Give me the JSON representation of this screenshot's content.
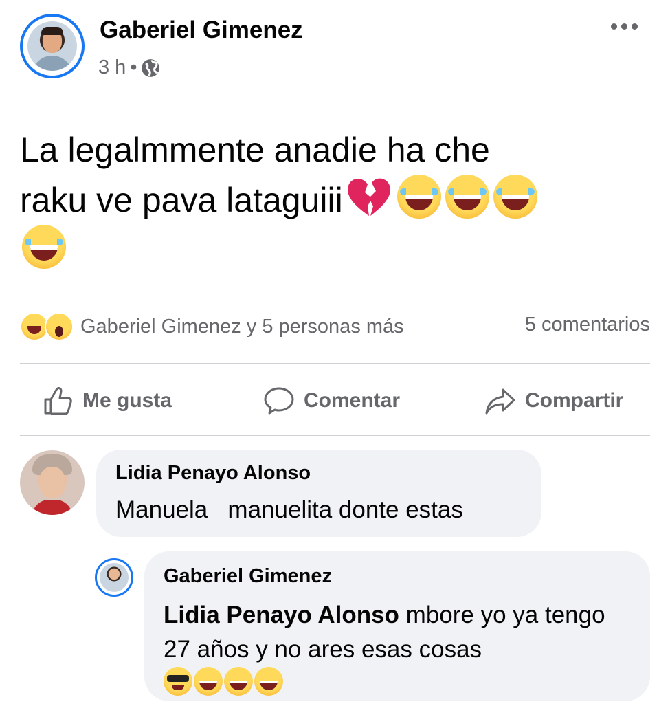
{
  "post": {
    "author": "Gaberiel Gimenez",
    "time": "3 h",
    "separator": "•",
    "text_line1": "La legalmmente anadie ha che",
    "text_line2": "raku ve  pava lataguiii",
    "emojis": [
      "broken-heart",
      "laughing-tears",
      "laughing-tears",
      "laughing-tears",
      "laughing-tears"
    ]
  },
  "reactions": {
    "icons": [
      "laughing-squint",
      "astonished"
    ],
    "summary": "Gaberiel Gimenez y 5 personas más",
    "comments_count": "5 comentarios"
  },
  "actions": {
    "like": "Me gusta",
    "comment": "Comentar",
    "share": "Compartir"
  },
  "comments": [
    {
      "author": "Lidia Penayo Alonso",
      "text": "Manuela   manuelita donte estas"
    },
    {
      "author": "Gaberiel Gimenez",
      "mention": "Lidia Penayo Alonso",
      "text": " mbore yo ya tengo 27 años y no ares esas cosas",
      "emojis": [
        "sunglasses-face",
        "laughing-tears",
        "laughing-tears",
        "laughing-tears"
      ]
    }
  ],
  "colors": {
    "accent": "#1877f2",
    "secondary_text": "#65676b",
    "bubble": "#f0f2f5"
  }
}
